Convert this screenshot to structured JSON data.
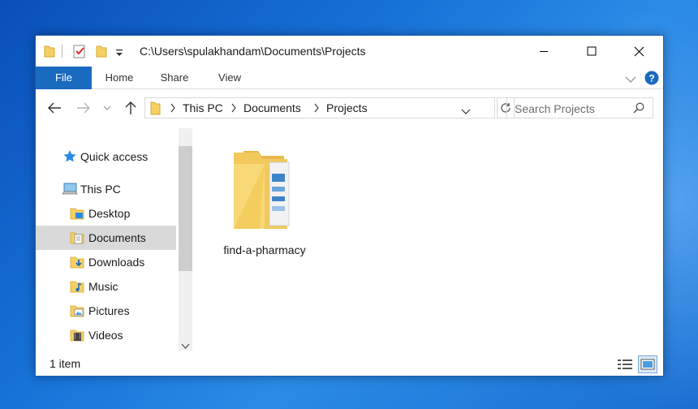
{
  "window": {
    "title_path": "C:\\Users\\spulakhandam\\Documents\\Projects"
  },
  "ribbon": {
    "tabs": [
      {
        "label": "File"
      },
      {
        "label": "Home"
      },
      {
        "label": "Share"
      },
      {
        "label": "View"
      }
    ]
  },
  "address": {
    "crumbs": [
      "This PC",
      "Documents",
      "Projects"
    ]
  },
  "search": {
    "placeholder": "Search Projects"
  },
  "nav": {
    "items": [
      {
        "label": "Quick access",
        "icon": "star-icon"
      },
      {
        "label": "This PC",
        "icon": "computer-icon"
      },
      {
        "label": "Desktop",
        "icon": "desktop-folder-icon"
      },
      {
        "label": "Documents",
        "icon": "documents-folder-icon"
      },
      {
        "label": "Downloads",
        "icon": "downloads-folder-icon"
      },
      {
        "label": "Music",
        "icon": "music-folder-icon"
      },
      {
        "label": "Pictures",
        "icon": "pictures-folder-icon"
      },
      {
        "label": "Videos",
        "icon": "videos-folder-icon"
      }
    ],
    "selected": "Documents"
  },
  "content": {
    "items": [
      {
        "name": "find-a-pharmacy",
        "icon": "folder-icon"
      }
    ]
  },
  "status": {
    "count": "1 item"
  },
  "colors": {
    "accent": "#1a6ac0",
    "folder": "#f5cf63",
    "selection": "#d9d9d9"
  }
}
